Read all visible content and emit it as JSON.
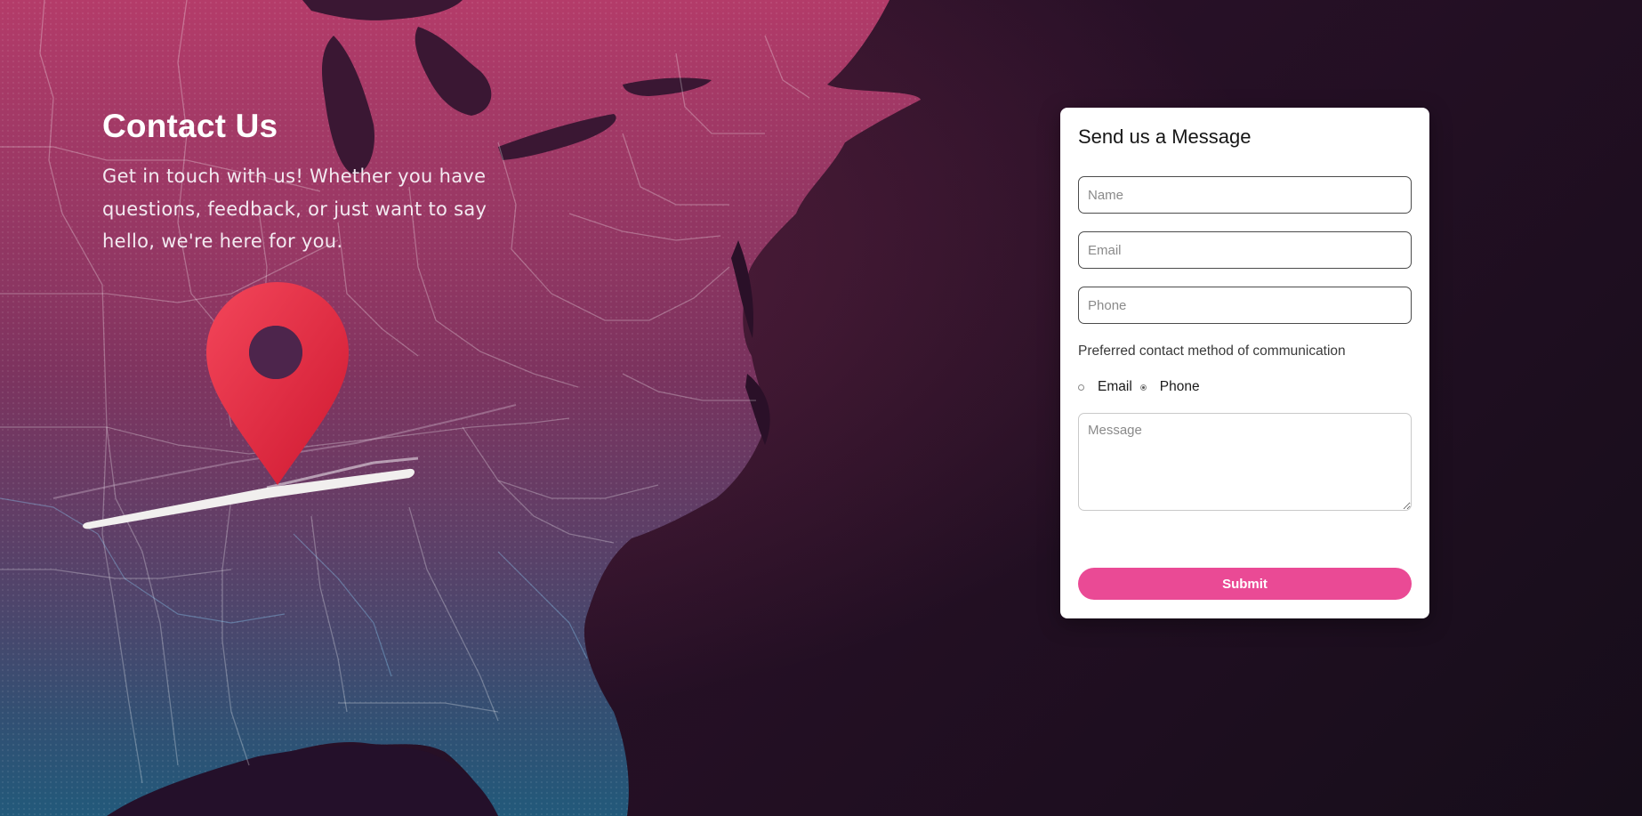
{
  "hero": {
    "title": "Contact Us",
    "text": "Get in touch with us! Whether you have questions, feedback, or just want to say hello, we're here for you."
  },
  "form": {
    "title": "Send us a Message",
    "name_placeholder": "Name",
    "email_placeholder": "Email",
    "phone_placeholder": "Phone",
    "preference_label": "Preferred contact method of communication",
    "options": [
      {
        "label": "Email",
        "checked": false
      },
      {
        "label": "Phone",
        "checked": true
      }
    ],
    "message_placeholder": "Message",
    "submit_label": "Submit"
  },
  "colors": {
    "accent": "#ea4a95",
    "pin": "#e8243f",
    "background": "#2a1128"
  },
  "icons": {
    "map": "us-east-map-illustration",
    "pin": "location-pin-icon"
  }
}
